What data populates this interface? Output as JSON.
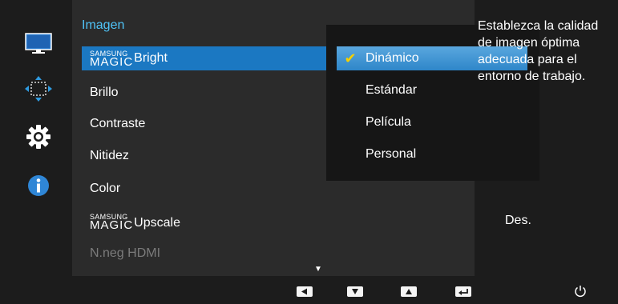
{
  "panel": {
    "title": "Imagen"
  },
  "menu": {
    "magic_bright": {
      "brand_top": "SAMSUNG",
      "brand_bottom": "MAGIC",
      "label": "Bright"
    },
    "items": [
      "Brillo",
      "Contraste",
      "Nitidez",
      "Color"
    ],
    "magic_upscale": {
      "brand_top": "SAMSUNG",
      "brand_bottom": "MAGIC",
      "label": "Upscale",
      "value": "Des."
    },
    "disabled_item": "N.neg HDMI"
  },
  "submenu": {
    "options": [
      "Dinámico",
      "Estándar",
      "Película",
      "Personal"
    ],
    "selected_index": 0
  },
  "help_text": "Establezca la calidad de imagen óptima adecuada para el entorno de trabajo.",
  "icons": {
    "sidebar": [
      "monitor-icon",
      "size-position-icon",
      "gear-icon",
      "info-icon"
    ],
    "bottom": [
      "left-arrow-icon",
      "down-arrow-icon",
      "up-arrow-icon",
      "enter-icon",
      "power-icon"
    ]
  },
  "colors": {
    "accent": "#4fc3f7",
    "highlight": "#1b78c2",
    "check": "#f5d000"
  }
}
